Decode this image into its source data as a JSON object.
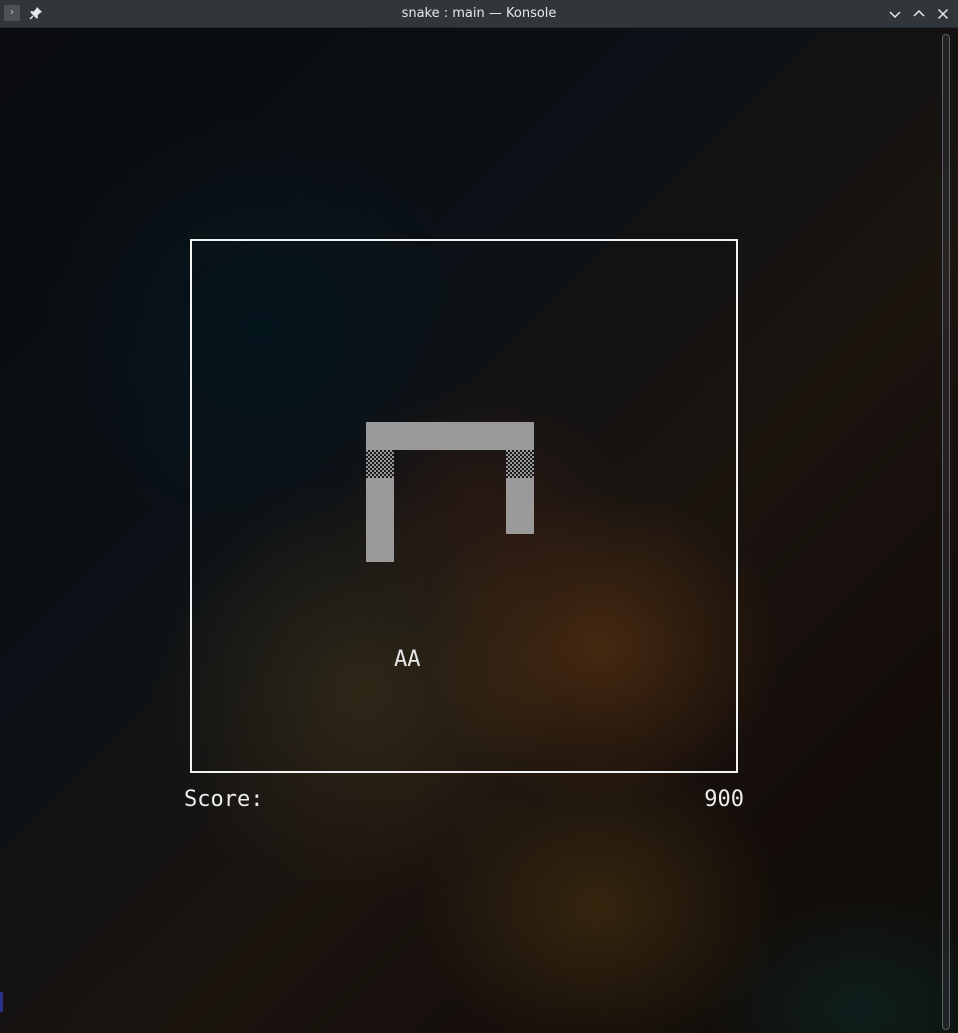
{
  "window": {
    "title": "snake : main — Konsole",
    "app_icon": "terminal-icon",
    "app_icon_glyph": "›",
    "pin_icon": "pin-icon",
    "controls": [
      "minimize-icon",
      "maximize-icon",
      "close-icon"
    ]
  },
  "game": {
    "apple_text": "AA",
    "score_label": "Score:",
    "score_value": "900",
    "snake_color": "#9a9a9a",
    "border_color": "#f2f2f2"
  }
}
